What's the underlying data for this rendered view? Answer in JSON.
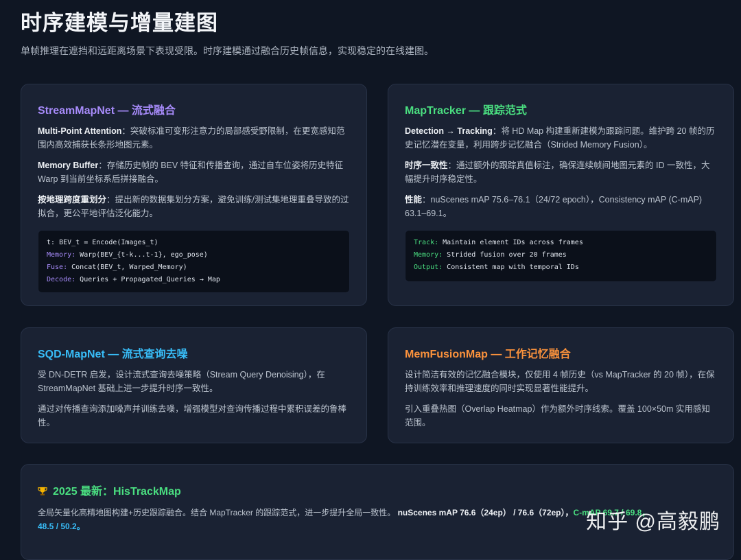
{
  "page": {
    "title": "时序建模与增量建图",
    "subtitle": "单帧推理在遮挡和远距离场景下表现受限。时序建模通过融合历史帧信息，实现稳定的在线建图。"
  },
  "colors": {
    "background": "#0f1623",
    "card": "#1a2233",
    "purple": "#a78bfa",
    "green": "#4ade80",
    "blue": "#38bdf8",
    "orange": "#fb923c"
  },
  "cards": {
    "streammapnet": {
      "title": "StreamMapNet — 流式融合",
      "p1_label": "Multi-Point Attention",
      "p1_text": "：突破标准可变形注意力的局部感受野限制，在更宽感知范围内高效捕获长条形地图元素。",
      "p2_label": "Memory Buffer",
      "p2_text": "：存储历史帧的 BEV 特征和传播查询，通过自车位姿将历史特征 Warp 到当前坐标系后拼接融合。",
      "p3_label": "按地理跨度重划分",
      "p3_text": "：提出新的数据集划分方案，避免训练/测试集地理重叠导致的过拟合，更公平地评估泛化能力。",
      "code": [
        {
          "key": "t:",
          "val": " BEV_t = Encode(Images_t)"
        },
        {
          "key": "Memory:",
          "val": " Warp(BEV_{t-k...t-1}, ego_pose)"
        },
        {
          "key": "Fuse:",
          "val": " Concat(BEV_t, Warped_Memory)"
        },
        {
          "key": "Decode:",
          "val": " Queries + Propagated_Queries → Map"
        }
      ]
    },
    "maptracker": {
      "title": "MapTracker — 跟踪范式",
      "p1_label": "Detection → Tracking",
      "p1_text": "：将 HD Map 构建重新建模为跟踪问题。维护跨 20 帧的历史记忆潜在变量，利用跨步记忆融合（Strided Memory Fusion）。",
      "p2_label": "时序一致性",
      "p2_text": "：通过额外的跟踪真值标注，确保连续帧间地图元素的 ID 一致性，大幅提升时序稳定性。",
      "p3_label": "性能",
      "p3_text": "：nuScenes mAP 75.6–76.1（24/72 epoch），Consistency mAP (C-mAP) 63.1–69.1。",
      "code": [
        {
          "key": "Track:",
          "val": " Maintain element IDs across frames"
        },
        {
          "key": "Memory:",
          "val": " Strided fusion over 20 frames"
        },
        {
          "key": "Output:",
          "val": " Consistent map with temporal IDs"
        }
      ]
    },
    "sqd": {
      "title": "SQD-MapNet — 流式查询去噪",
      "p1": "受 DN-DETR 启发，设计流式查询去噪策略（Stream Query Denoising），在 StreamMapNet 基础上进一步提升时序一致性。",
      "p2": "通过对传播查询添加噪声并训练去噪，增强模型对查询传播过程中累积误差的鲁棒性。"
    },
    "memfusion": {
      "title": "MemFusionMap — 工作记忆融合",
      "p1": "设计简洁有效的记忆融合模块，仅使用 4 帧历史（vs MapTracker 的 20 帧），在保持训练效率和推理速度的同时实现显著性能提升。",
      "p2": "引入重叠热图（Overlap Heatmap）作为额外时序线索。覆盖 100×50m 实用感知范围。"
    },
    "histrack": {
      "icon": "trophy-icon",
      "title": "2025 最新：HisTrackMap",
      "text": "全局矢量化高精地图构建+历史跟踪融合。结合 MapTracker 的跟踪范式，进一步提升全局一致性。",
      "metric_bold": "nuScenes mAP 76.6（24ep） / 76.6（72ep），",
      "metric_hidden": "C-mAP 69.7 / 69.8，",
      "metric_tail": "48.5 / 50.2。"
    }
  },
  "watermark": "知乎 @高毅鹏"
}
